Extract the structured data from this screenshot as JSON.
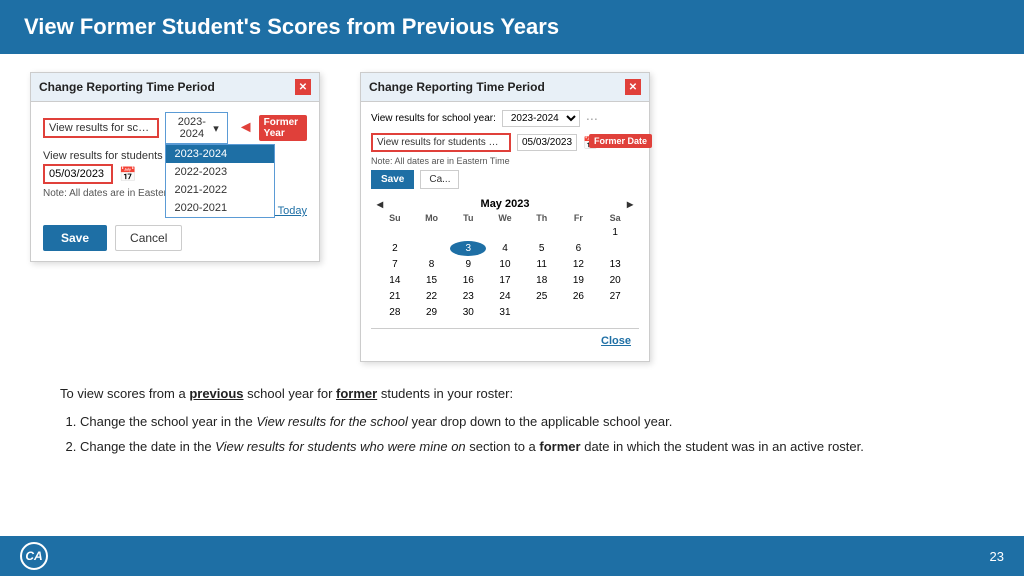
{
  "header": {
    "title": "View Former Student's Scores from Previous Years"
  },
  "left_dialog": {
    "title": "Change Reporting Time Period",
    "field_label": "View results for school year",
    "dropdown_selected": "2023-2024",
    "dropdown_arrow": "▾",
    "dropdown_options": [
      {
        "value": "2023-2024",
        "selected": true
      },
      {
        "value": "2022-2023",
        "selected": false
      },
      {
        "value": "2021-2022",
        "selected": false
      },
      {
        "value": "2020-2021",
        "selected": false
      }
    ],
    "students_label": "View results for students who...",
    "date_placeholder": "05/03/2023",
    "eastern_note": "Note: All dates are in Eastern Time",
    "reset_link": "Reset To Today",
    "save_btn": "Save",
    "cancel_btn": "Cancel",
    "former_year_badge": "Former Year"
  },
  "right_dialog": {
    "title": "Change Reporting Time Period",
    "school_year_label": "View results for school year:",
    "school_year_value": "2023-2024",
    "students_field": "View results for students who were mine on",
    "date_value": "05/03/2023",
    "eastern_note": "Note: All dates are in Eastern Time",
    "save_btn": "Save",
    "cancel_btn": "Ca...",
    "calendar": {
      "month_year": "May 2023",
      "day_names": [
        "Su",
        "Mo",
        "Tu",
        "We",
        "Th",
        "Fr",
        "Sa"
      ],
      "weeks": [
        [
          "",
          "",
          "",
          "",
          "",
          "",
          "1"
        ],
        [
          "2",
          "",
          "3",
          "",
          "",
          "",
          ""
        ],
        [
          "7",
          "8",
          "9",
          "10",
          "11",
          "12",
          "13"
        ],
        [
          "14",
          "15",
          "16",
          "17",
          "18",
          "19",
          "20"
        ],
        [
          "21",
          "22",
          "23",
          "24",
          "25",
          "26",
          "27"
        ],
        [
          "28",
          "29",
          "30",
          "31",
          "",
          "",
          ""
        ]
      ],
      "highlighted_day": "3",
      "week2_values": [
        "2",
        "",
        "3",
        "4",
        "5",
        "6",
        ""
      ]
    },
    "former_date_badge": "Former Date",
    "close_btn": "Close"
  },
  "text_content": {
    "intro": "To view scores from a ",
    "intro_previous": "previous",
    "intro_middle": " school year for ",
    "intro_former": "former",
    "intro_end": " students in your roster:",
    "step1": "Change the school year in the ",
    "step1_italic": "View results for the school",
    "step1_end": " year drop down to the applicable school year.",
    "step2": "Change the date in the ",
    "step2_italic": "View results for students who were mine on",
    "step2_middle": " section to a ",
    "step2_bold": "former",
    "step2_end": " date in which the student was in an active roster."
  },
  "footer": {
    "logo_text": "CA",
    "page_number": "23"
  }
}
